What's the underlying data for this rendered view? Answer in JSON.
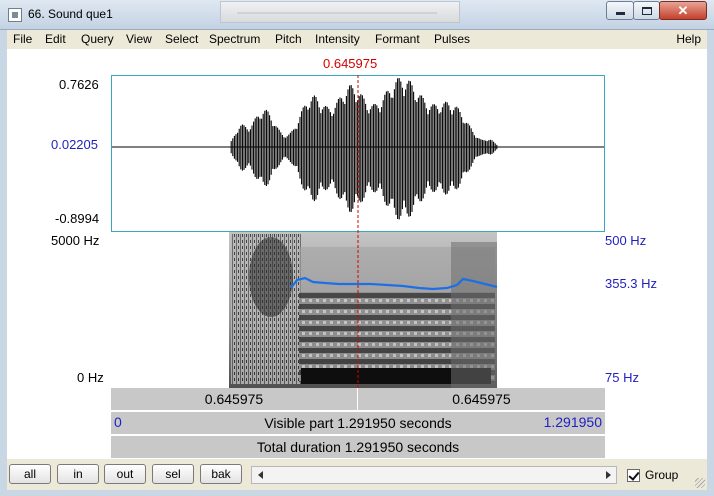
{
  "window": {
    "title": "66. Sound que1",
    "controls": {
      "minimize_icon": "minimize-icon",
      "maximize_icon": "maximize-icon",
      "close_glyph": "✕"
    }
  },
  "menu": {
    "items": [
      "File",
      "Edit",
      "Query",
      "View",
      "Select",
      "Spectrum",
      "Pitch",
      "Intensity",
      "Formant",
      "Pulses"
    ],
    "help": "Help"
  },
  "waveform": {
    "cursor_time": "0.645975",
    "y_max": "0.7626",
    "y_cursor": "0.02205",
    "y_min": "-0.8994"
  },
  "spectrogram": {
    "freq_top": "5000 Hz",
    "freq_bottom": "0 Hz",
    "pitch_top": "500 Hz",
    "pitch_cursor": "355.3 Hz",
    "pitch_bottom": "75 Hz"
  },
  "time_bars": {
    "left_selection": "0.645975",
    "right_selection": "0.645975",
    "visible_start": "0",
    "visible_label": "Visible part 1.291950 seconds",
    "visible_end": "1.291950",
    "total_label": "Total duration 1.291950 seconds"
  },
  "bottom": {
    "buttons": [
      "all",
      "in",
      "out",
      "sel",
      "bak"
    ],
    "group_label": "Group",
    "group_checked": true
  },
  "colors": {
    "cursor": "#d40000",
    "label_blue": "#1f1fbf",
    "pitch_line": "#1e6fe6",
    "bar_gray": "#c8c8c8"
  }
}
